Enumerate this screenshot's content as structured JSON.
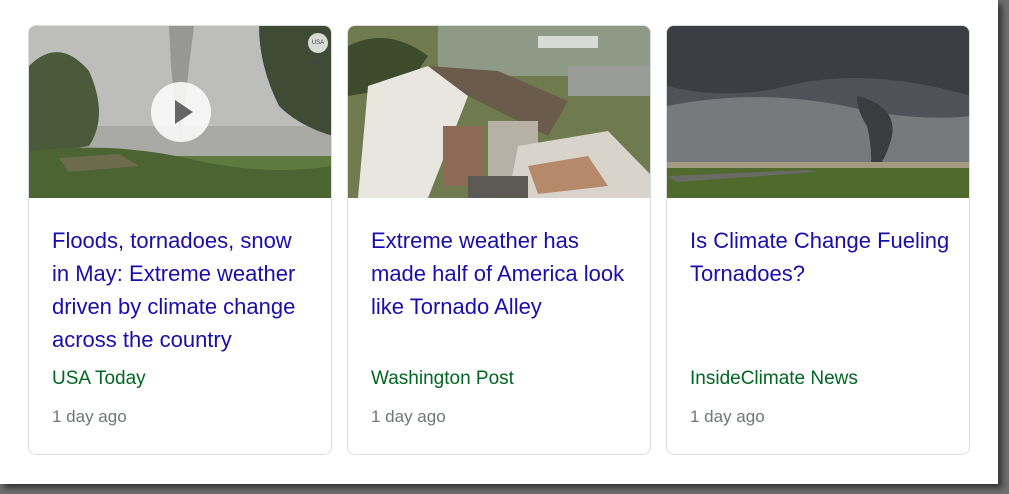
{
  "cards": [
    {
      "title": "Floods, tornadoes, snow in May: Extreme weather driven by climate change across the country",
      "source": "USA Today",
      "time": "1 day ago",
      "badge": "USA TODAY"
    },
    {
      "title": "Extreme weather has made half of America look like Tornado Alley",
      "source": "Washington Post",
      "time": "1 day ago"
    },
    {
      "title": "Is Climate Change Fueling Tornadoes?",
      "source": "InsideClimate News",
      "time": "1 day ago"
    }
  ],
  "colors": {
    "title": "#1a0dab",
    "source": "#006621",
    "time": "#70757a",
    "border": "#dadce0"
  }
}
